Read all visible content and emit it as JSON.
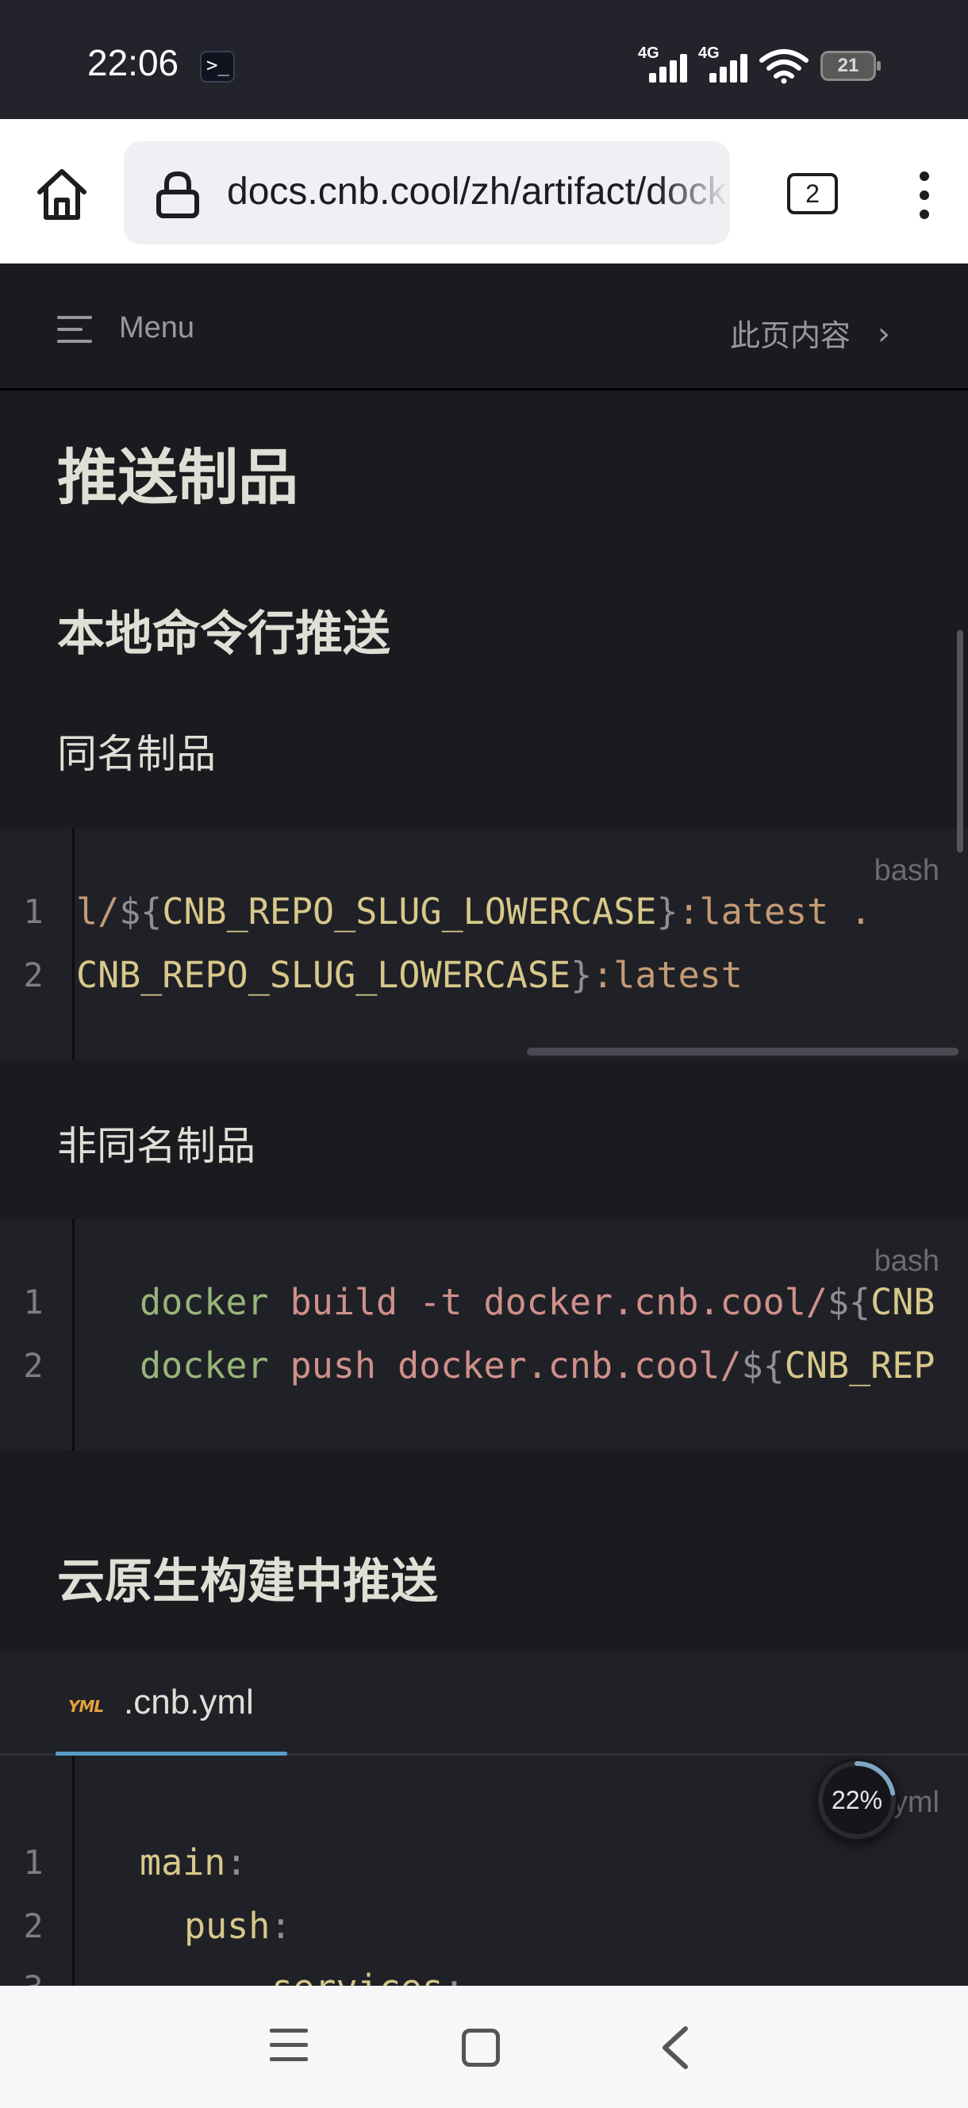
{
  "status_bar": {
    "time": "22:06",
    "terminal_glyph": ">_",
    "sim1": "4G",
    "sim2": "4G",
    "battery": "21"
  },
  "browser": {
    "url": "docs.cnb.cool/zh/artifact/docker",
    "tab_count": "2"
  },
  "doc_nav": {
    "menu_label": "Menu",
    "toc_label": "此页内容",
    "toc_chevron": "›"
  },
  "content": {
    "page_title": "推送制品",
    "section_local": "本地命令行推送",
    "same_name_label": "同名制品",
    "different_name_label": "非同名制品",
    "section_cloud": "云原生构建中推送"
  },
  "code_block_1": {
    "lang": "bash",
    "line_numbers": [
      "1",
      "2"
    ],
    "line1": {
      "a": "l/",
      "b": "${",
      "c": "CNB_REPO_SLUG_LOWERCASE",
      "d": "}",
      "e": ":latest ."
    },
    "line2": {
      "a": "CNB_REPO_SLUG_LOWERCASE",
      "b": "}",
      "c": ":latest"
    }
  },
  "code_block_2": {
    "lang": "bash",
    "line_numbers": [
      "1",
      "2"
    ],
    "line1": {
      "cmd": "docker",
      "args": " build -t docker.cnb.cool/",
      "var_open": "${",
      "var": "CNB"
    },
    "line2": {
      "cmd": "docker",
      "args": " push docker.cnb.cool/",
      "var_open": "${",
      "var": "CNB_REP"
    }
  },
  "code_block_3": {
    "file_tab": ".cnb.yml",
    "file_icon_text": "YML",
    "lang": "yml",
    "line_numbers": [
      "1",
      "2",
      "3"
    ],
    "line1": {
      "key": "main",
      "punc": ":"
    },
    "line2": {
      "key": "push",
      "punc": ":"
    },
    "line3": {
      "dash": "- ",
      "key": "services",
      "punc": ":"
    }
  },
  "reading_progress": {
    "label": "22%",
    "value": 0.22
  },
  "colors": {
    "page_bg": "#1b1b1f",
    "code_bg": "#202127",
    "accent_underline": "#5a9cc8",
    "yml_icon": "#e6a13c"
  }
}
